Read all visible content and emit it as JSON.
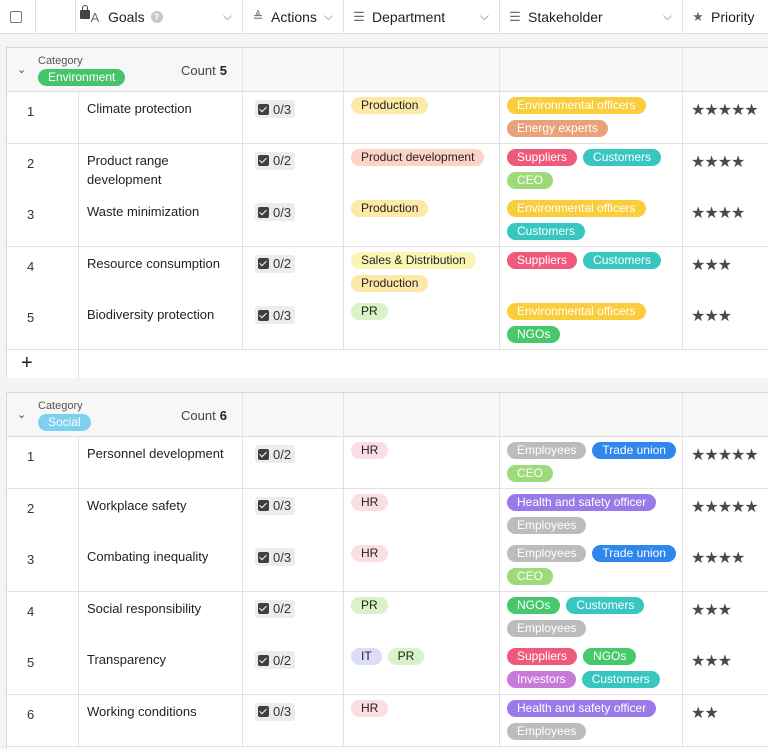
{
  "header": {
    "goals_label": "Goals",
    "goals_help": "?",
    "actions_label": "Actions",
    "department_label": "Department",
    "stakeholder_label": "Stakeholder",
    "priority_label": "Priority"
  },
  "groups": [
    {
      "category_label": "Category",
      "category": "Environment",
      "count_label": "Count",
      "count": "5",
      "color": "#47c468",
      "rows": [
        {
          "n": "1",
          "goal": "Climate protection",
          "actions": "0/3",
          "dept": [
            [
              "Production",
              "#fce9a7",
              "#222"
            ]
          ],
          "stake": [
            [
              "Environmental officers",
              "#f9cd3c",
              "#fff"
            ],
            [
              "Energy experts",
              "#e8a27a",
              "#fff"
            ]
          ],
          "prio": "★★★★★"
        },
        {
          "n": "2",
          "goal": "Product range development",
          "actions": "0/2",
          "dept": [
            [
              "Product development",
              "#fbd3c8",
              "#222"
            ]
          ],
          "stake": [
            [
              "Suppliers",
              "#ef5a7a",
              "#fff"
            ],
            [
              "Customers",
              "#37c7c0",
              "#fff"
            ],
            [
              "CEO",
              "#9ed97a",
              "#fff"
            ]
          ],
          "prio": "★★★★"
        },
        {
          "n": "3",
          "goal": "Waste minimization",
          "actions": "0/3",
          "dept": [
            [
              "Production",
              "#fce9a7",
              "#222"
            ]
          ],
          "stake": [
            [
              "Environmental officers",
              "#f9cd3c",
              "#fff"
            ],
            [
              "Customers",
              "#37c7c0",
              "#fff"
            ]
          ],
          "prio": "★★★★"
        },
        {
          "n": "4",
          "goal": "Resource consumption",
          "actions": "0/2",
          "dept": [
            [
              "Sales & Distribution",
              "#fbf5b4",
              "#222"
            ],
            [
              "Production",
              "#fce9a7",
              "#222"
            ]
          ],
          "stake": [
            [
              "Suppliers",
              "#ef5a7a",
              "#fff"
            ],
            [
              "Customers",
              "#37c7c0",
              "#fff"
            ]
          ],
          "prio": "★★★"
        },
        {
          "n": "5",
          "goal": "Biodiversity protection",
          "actions": "0/3",
          "dept": [
            [
              "PR",
              "#d7f3c7",
              "#222"
            ]
          ],
          "stake": [
            [
              "Environmental officers",
              "#f9cd3c",
              "#fff"
            ],
            [
              "NGOs",
              "#46c86b",
              "#fff"
            ]
          ],
          "prio": "★★★"
        }
      ]
    },
    {
      "category_label": "Category",
      "category": "Social",
      "count_label": "Count",
      "count": "6",
      "color": "#7ed0ef",
      "rows": [
        {
          "n": "1",
          "goal": "Personnel development",
          "actions": "0/2",
          "dept": [
            [
              "HR",
              "#fbdde4",
              "#222"
            ]
          ],
          "stake": [
            [
              "Employees",
              "#bcbcbc",
              "#fff"
            ],
            [
              "Trade union",
              "#2f86ec",
              "#fff"
            ],
            [
              "CEO",
              "#9ed97a",
              "#fff"
            ]
          ],
          "prio": "★★★★★"
        },
        {
          "n": "2",
          "goal": "Workplace safety",
          "actions": "0/3",
          "dept": [
            [
              "HR",
              "#fbdde4",
              "#222"
            ]
          ],
          "stake": [
            [
              "Health and safety officer",
              "#9a7ae8",
              "#fff"
            ],
            [
              "Employees",
              "#bcbcbc",
              "#fff"
            ]
          ],
          "prio": "★★★★★"
        },
        {
          "n": "3",
          "goal": "Combating inequality",
          "actions": "0/3",
          "dept": [
            [
              "HR",
              "#fbdde4",
              "#222"
            ]
          ],
          "stake": [
            [
              "Employees",
              "#bcbcbc",
              "#fff"
            ],
            [
              "Trade union",
              "#2f86ec",
              "#fff"
            ],
            [
              "CEO",
              "#9ed97a",
              "#fff"
            ]
          ],
          "prio": "★★★★"
        },
        {
          "n": "4",
          "goal": "Social responsibility",
          "actions": "0/2",
          "dept": [
            [
              "PR",
              "#d7f3c7",
              "#222"
            ]
          ],
          "stake": [
            [
              "NGOs",
              "#46c86b",
              "#fff"
            ],
            [
              "Customers",
              "#37c7c0",
              "#fff"
            ],
            [
              "Employees",
              "#bcbcbc",
              "#fff"
            ]
          ],
          "prio": "★★★"
        },
        {
          "n": "5",
          "goal": "Transparency",
          "actions": "0/2",
          "dept": [
            [
              "IT",
              "#dcdcfb",
              "#222"
            ],
            [
              "PR",
              "#d7f3c7",
              "#222"
            ]
          ],
          "stake": [
            [
              "Suppliers",
              "#ef5a7a",
              "#fff"
            ],
            [
              "NGOs",
              "#46c86b",
              "#fff"
            ],
            [
              "Investors",
              "#c77ad8",
              "#fff"
            ],
            [
              "Customers",
              "#37c7c0",
              "#fff"
            ]
          ],
          "prio": "★★★"
        },
        {
          "n": "6",
          "goal": "Working conditions",
          "actions": "0/3",
          "dept": [
            [
              "HR",
              "#fbdde4",
              "#222"
            ]
          ],
          "stake": [
            [
              "Health and safety officer",
              "#9a7ae8",
              "#fff"
            ],
            [
              "Employees",
              "#bcbcbc",
              "#fff"
            ]
          ],
          "prio": "★★"
        }
      ]
    }
  ],
  "add_row_label": "+"
}
